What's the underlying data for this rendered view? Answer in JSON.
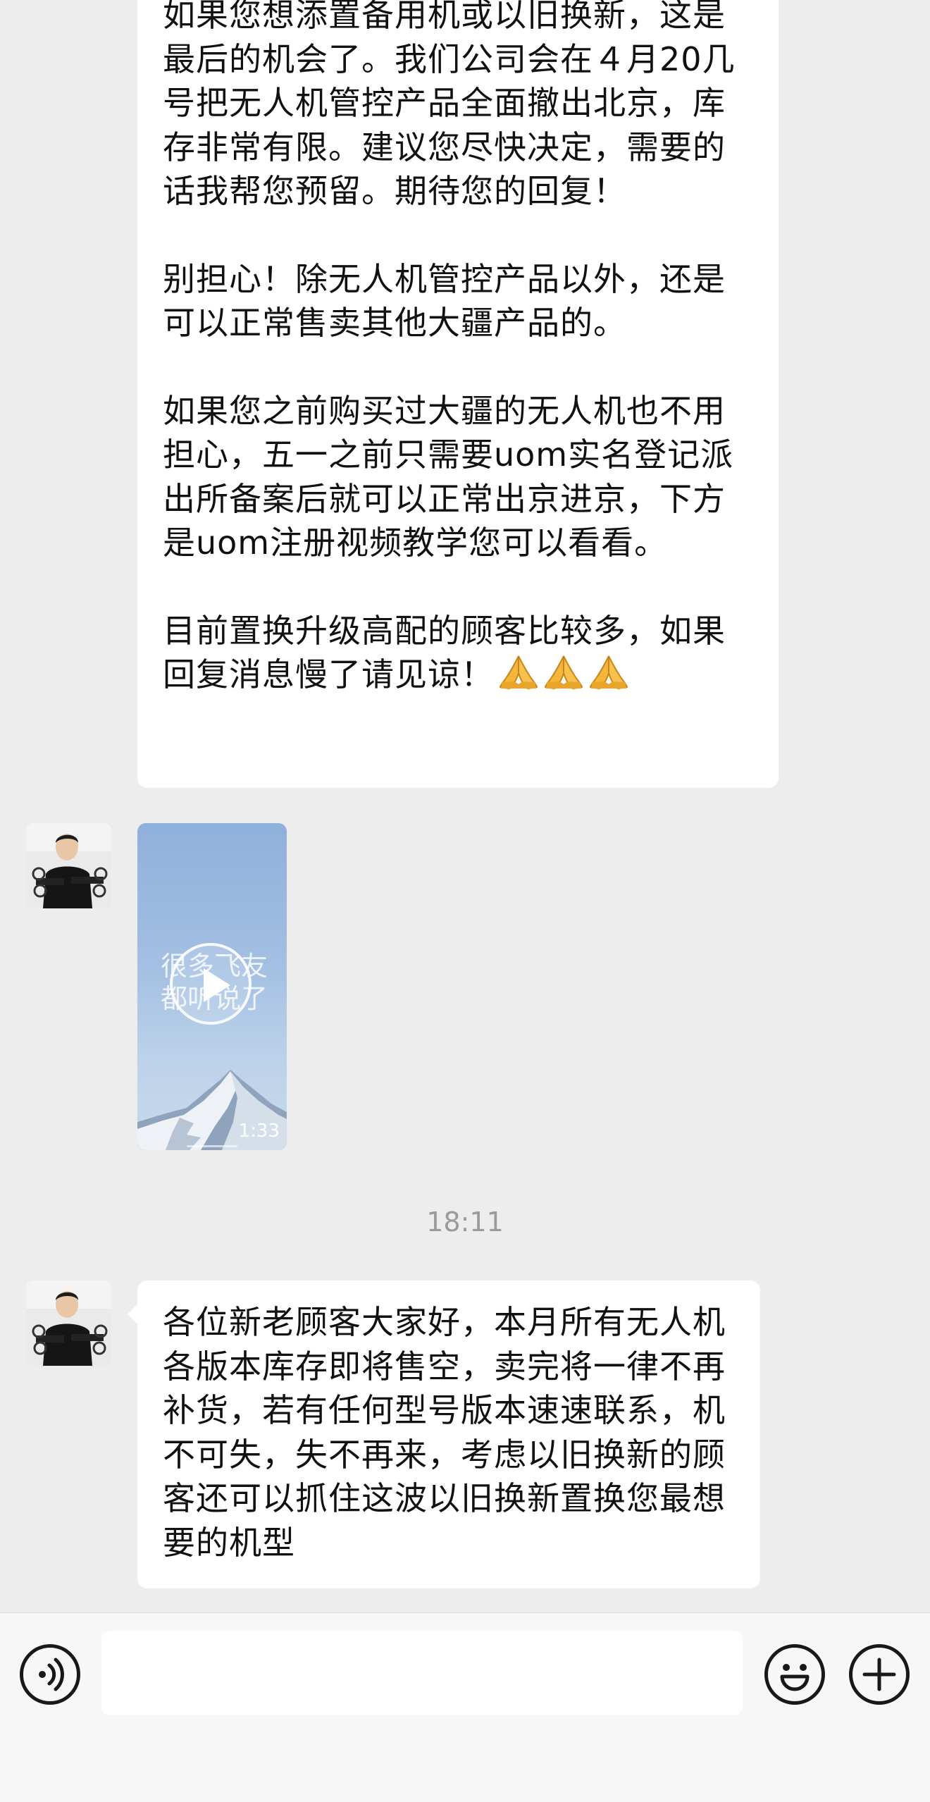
{
  "messages": [
    {
      "type": "text",
      "paragraphs": [
        "如果您想添置备用机或以旧换新，这是最后的机会了。我们公司会在４月20几号把无人机管控产品全面撤出北京，库存非常有限。建议您尽快决定，需要的话我帮您预留。期待您的回复！",
        "别担心！除无人机管控产品以外，还是可以正常售卖其他大疆产品的。",
        "如果您之前购买过大疆的无人机也不用担心，五一之前只需要uom实名登记派出所备案后就可以正常出京进京，下方是uom注册视频教学您可以看看。",
        "目前置换升级高配的顾客比较多，如果回复消息慢了请见谅！"
      ],
      "trailing_icons": [
        "folded-hands-icon",
        "folded-hands-icon",
        "folded-hands-icon"
      ]
    },
    {
      "type": "video",
      "caption": "很多飞友都听说了",
      "duration": "1:33",
      "icon": "play-icon"
    },
    {
      "type": "timestamp",
      "time": "18:11"
    },
    {
      "type": "text",
      "paragraphs": [
        "各位新老顾客大家好，本月所有无人机各版本库存即将售空，卖完将一律不再补货，若有任何型号版本速速联系，机不可失，失不再来，考虑以旧换新的顾客还可以抓住这波以旧换新置换您最想要的机型"
      ]
    }
  ],
  "input_bar": {
    "voice_icon": "voice-icon",
    "input_value": "",
    "emoji_icon": "emoji-icon",
    "plus_icon": "plus-icon"
  },
  "colors": {
    "chat_background": "#ededed",
    "bubble": "#ffffff",
    "input_bar": "#f7f7f7",
    "timestamp": "#9a9a9a"
  }
}
